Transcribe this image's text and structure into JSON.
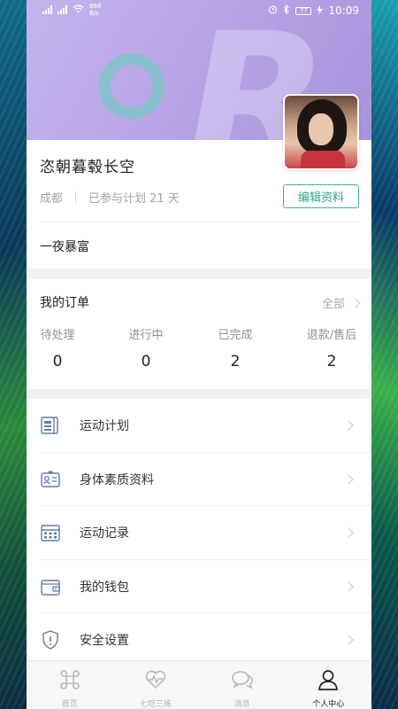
{
  "status_bar": {
    "network_speed": "868\nB/s",
    "battery": "77",
    "time": "10:09"
  },
  "profile": {
    "username": "恣朝暮毂长空",
    "city": "成都",
    "plan_days": "已参与计划 21 天",
    "edit_label": "编辑资料",
    "signature": "一夜暴富"
  },
  "orders": {
    "title": "我的订单",
    "all_label": "全部",
    "stats": [
      {
        "label": "待处理",
        "count": "0"
      },
      {
        "label": "进行中",
        "count": "0"
      },
      {
        "label": "已完成",
        "count": "2"
      },
      {
        "label": "退款/售后",
        "count": "2"
      }
    ]
  },
  "menu": [
    {
      "label": "运动计划",
      "icon": "plan-icon"
    },
    {
      "label": "身体素质资料",
      "icon": "id-card-icon"
    },
    {
      "label": "运动记录",
      "icon": "calendar-icon"
    },
    {
      "label": "我的钱包",
      "icon": "wallet-icon"
    },
    {
      "label": "安全设置",
      "icon": "shield-icon"
    }
  ],
  "tabs": [
    {
      "label": "首页",
      "icon": "command-icon",
      "active": false
    },
    {
      "label": "七吃三练",
      "icon": "heartbeat-icon",
      "active": false
    },
    {
      "label": "消息",
      "icon": "chat-icon",
      "active": false
    },
    {
      "label": "个人中心",
      "icon": "person-icon",
      "active": true
    }
  ],
  "colors": {
    "accent": "#2aa88c",
    "banner": "#b8a5e6"
  }
}
